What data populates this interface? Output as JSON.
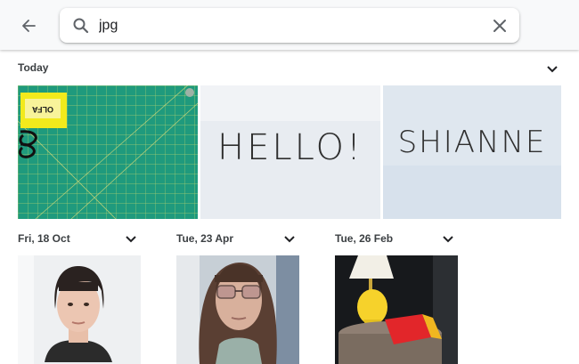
{
  "search": {
    "query": "jpg",
    "back_icon": "arrow-left-icon",
    "search_icon": "search-icon",
    "clear_icon": "close-icon"
  },
  "groups": [
    {
      "date": "Today",
      "photos": [
        {
          "subject": "green cutting mat",
          "mat_text": "OLFA"
        },
        {
          "subject": "paper with handwriting",
          "text": "HELLO!"
        },
        {
          "subject": "paper with handwriting",
          "text": "SHIANNE"
        }
      ]
    },
    {
      "date": "Fri, 18 Oct",
      "photos": [
        {
          "subject": "portrait"
        }
      ]
    },
    {
      "date": "Tue, 23 Apr",
      "photos": [
        {
          "subject": "portrait with glasses"
        }
      ]
    },
    {
      "date": "Tue, 26 Feb",
      "photos": [
        {
          "subject": "yellow lamp on table"
        }
      ]
    }
  ],
  "colors": {
    "topbar": "#f8f9fa",
    "text": "#202124",
    "mat_green": "#1f9a7d"
  }
}
